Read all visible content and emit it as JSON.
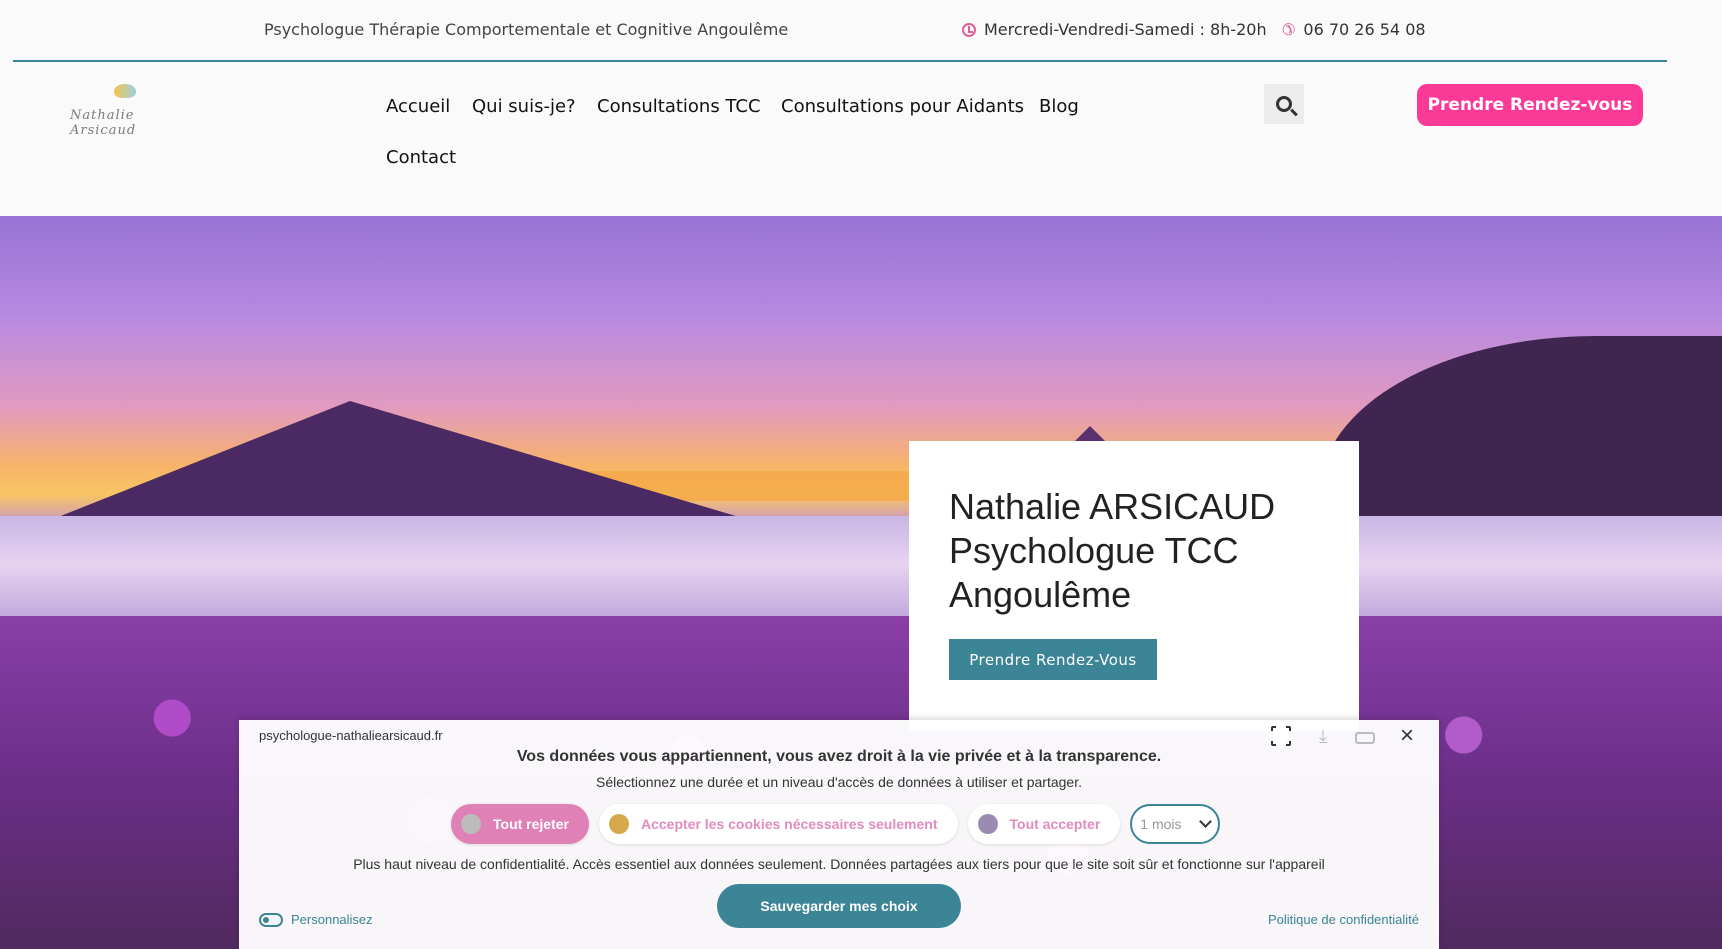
{
  "topbar": {
    "tagline": "Psychologue Thérapie Comportementale et Cognitive Angoulême",
    "hours": "Mercredi-Vendredi-Samedi : 8h-20h",
    "phone": "06 70 26 54 08"
  },
  "header": {
    "logo_alt": "Nathalie Arsicaud",
    "nav": [
      "Accueil",
      "Qui suis-je?",
      "Consultations TCC",
      "Consultations pour Aidants",
      "Blog",
      "Contact"
    ],
    "cta_label": "Prendre Rendez-vous",
    "search_icon": "search-icon"
  },
  "hero": {
    "title_lines": [
      "Nathalie ARSICAUD",
      "Psychologue TCC",
      "Angoulême"
    ],
    "cta_label": "Prendre Rendez-Vous"
  },
  "cookie": {
    "site": "psychologue-nathaliearsicaud.fr",
    "title": "Vos données vous appartiennent, vous avez droit à la vie privée et à la transparence.",
    "subtitle": "Sélectionnez une durée et un niveau d'accès de données à utiliser et partager.",
    "reject_label": "Tout rejeter",
    "necessary_label": "Accepter les cookies nécessaires seulement",
    "accept_label": "Tout accepter",
    "duration_value": "1 mois",
    "description": "Plus haut niveau de confidentialité. Accès essentiel aux données seulement. Données partagées aux tiers pour que le site soit sûr et fonctionne sur l'appareil",
    "save_label": "Sauvegarder mes choix",
    "customize_label": "Personnalisez",
    "policy_label": "Politique de confidentialité"
  },
  "colors": {
    "accent_teal": "#3b8596",
    "brand_pink": "#fb3a97"
  }
}
